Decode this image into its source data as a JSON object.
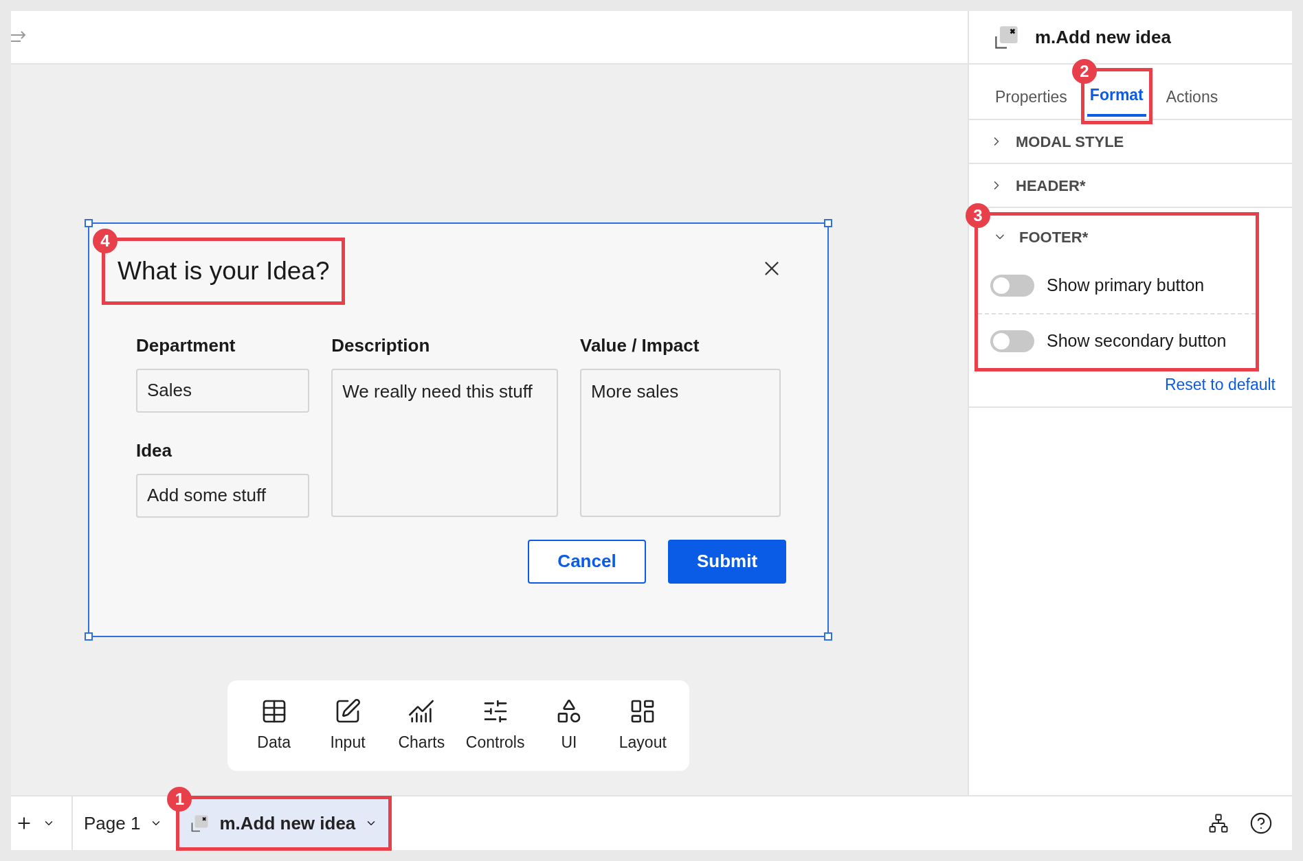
{
  "canvas": {
    "modal": {
      "title": "What is your Idea?",
      "columns": [
        [
          {
            "label": "Department",
            "value": "Sales",
            "multiline": false
          },
          {
            "label": "Idea",
            "value": "Add some stuff",
            "multiline": false
          }
        ],
        [
          {
            "label": "Description",
            "value": "We really need this stuff",
            "multiline": true
          }
        ],
        [
          {
            "label": "Value / Impact",
            "value": "More sales",
            "multiline": true
          }
        ]
      ],
      "buttons": [
        {
          "label": "Cancel",
          "kind": "secondary"
        },
        {
          "label": "Submit",
          "kind": "primary"
        }
      ]
    },
    "toolbar": [
      {
        "label": "Data"
      },
      {
        "label": "Input"
      },
      {
        "label": "Charts"
      },
      {
        "label": "Controls"
      },
      {
        "label": "UI"
      },
      {
        "label": "Layout"
      }
    ]
  },
  "panel": {
    "title": "m.Add new idea",
    "tabs": [
      {
        "label": "Properties",
        "selected": false
      },
      {
        "label": "Format",
        "selected": true
      },
      {
        "label": "Actions",
        "selected": false
      }
    ],
    "sections": [
      {
        "title": "MODAL STYLE",
        "expanded": false
      },
      {
        "title": "HEADER*",
        "expanded": false
      },
      {
        "title": "FOOTER*",
        "expanded": true,
        "toggles": [
          {
            "label": "Show primary button",
            "on": false
          },
          {
            "label": "Show secondary button",
            "on": false
          }
        ]
      }
    ],
    "reset_link": "Reset to default"
  },
  "bottom_bar": {
    "pages": [
      {
        "label": "Page 1",
        "selected": false
      },
      {
        "label": "m.Add new idea",
        "selected": true
      }
    ]
  },
  "annotations": [
    "1",
    "2",
    "3",
    "4"
  ]
}
